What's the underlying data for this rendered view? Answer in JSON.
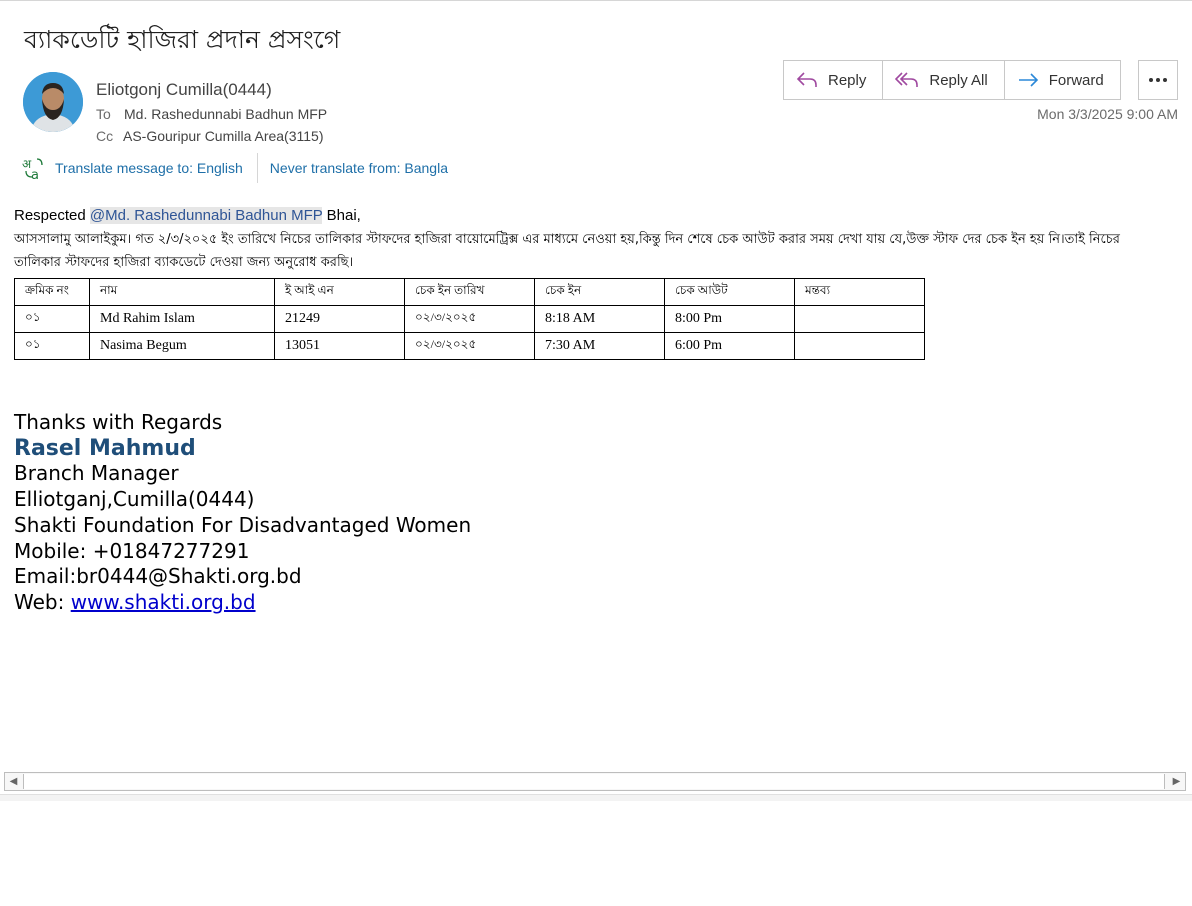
{
  "subject": "ব্যাকডেটি হাজিরা প্রদান প্রসংগে",
  "sender": "Eliotgonj Cumilla(0444)",
  "to_label": "To",
  "to_value": "Md. Rashedunnabi Badhun MFP",
  "cc_label": "Cc",
  "cc_value": "AS-Gouripur Cumilla Area(3115)",
  "actions": {
    "reply": "Reply",
    "reply_all": "Reply All",
    "forward": "Forward"
  },
  "date": "Mon 3/3/2025 9:00 AM",
  "translate": {
    "to": "Translate message to: English",
    "never": "Never translate from: Bangla"
  },
  "greeting": {
    "prefix": "Respected ",
    "mention": "@Md. Rashedunnabi Badhun MFP",
    "suffix": " Bhai,"
  },
  "body": "আসসালামু আলাইকুম। গত ২/৩/২০২৫ ইং তারিখে নিচের তালিকার স্টাফদের হাজিরা বায়োমেট্রিক্স এর মাধ্যমে নেওয়া হয়,কিন্তু দিন শেষে চেক আউট করার সময় দেখা যায় যে,উক্ত স্টাফ দের চেক ইন হয় নি।তাই নিচের তালিকার স্টাফদের হাজিরা ব্যাকডেটে দেওয়া জন্য অনুরোধ করছি।",
  "table": {
    "headers": [
      "ক্রমিক নং",
      "নাম",
      "ই আই এন",
      "চেক ইন তারিখ",
      "চেক ইন",
      "চেক আউট",
      "মন্তব্য"
    ],
    "rows": [
      [
        "০১",
        "Md Rahim Islam",
        "21249",
        "০২/৩/২০২৫",
        "8:18 AM",
        "8:00 Pm",
        ""
      ],
      [
        "০১",
        "Nasima Begum",
        "13051",
        "০২/৩/২০২৫",
        "7:30 AM",
        "6:00 Pm",
        ""
      ]
    ]
  },
  "signature": {
    "thanks": "Thanks with Regards",
    "name": "Rasel Mahmud",
    "title": "Branch Manager",
    "branch": "Elliotganj,Cumilla(0444)",
    "org": "Shakti Foundation For Disadvantaged Women",
    "mobile": "Mobile: +01847277291",
    "email": "Email:br0444@Shakti.org.bd",
    "web_label": "Web: ",
    "web_link": "www.shakti.org.bd"
  },
  "colors": {
    "link": "#1e6fa8",
    "reply_icon": "#a04aa0",
    "forward_icon": "#2b88d8",
    "signature_name": "#1f4e79"
  }
}
